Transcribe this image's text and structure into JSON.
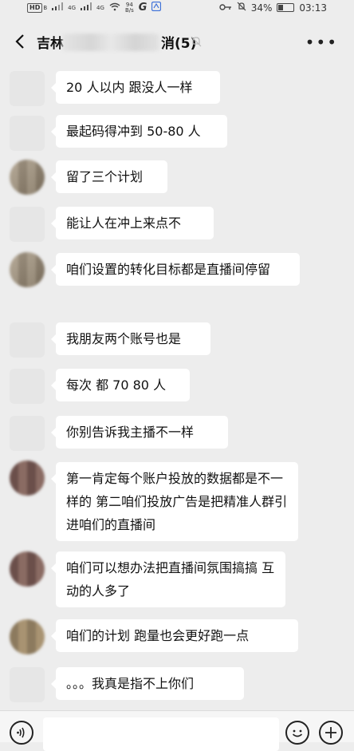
{
  "status_bar": {
    "net_badge": "HD",
    "net_badge_sub": "B",
    "signal1": "4G",
    "signal2": "4G",
    "speed_value": "94",
    "speed_unit": "B/s",
    "app_icon1": "G",
    "battery_percent": "34%",
    "time": "03:13"
  },
  "header": {
    "title_prefix": "吉林",
    "title_suffix": "消(5)",
    "back_icon": "chevron-left",
    "mute_icon": "bell-off",
    "more_icon": "ellipsis"
  },
  "messages": [
    {
      "text": "20 人以内 跟没人一样",
      "avatar": "blank"
    },
    {
      "text": "最起码得冲到 50-80 人",
      "avatar": "blank"
    },
    {
      "text": "留了三个计划",
      "avatar": "pix"
    },
    {
      "text": "能让人在冲上来点不",
      "avatar": "blank"
    },
    {
      "text": "咱们设置的转化目标都是直播间停留",
      "avatar": "pix"
    },
    {
      "text": "我朋友两个账号也是",
      "avatar": "blank"
    },
    {
      "text": "每次 都  70 80 人",
      "avatar": "blank"
    },
    {
      "text": "你别告诉我主播不一样",
      "avatar": "blank"
    },
    {
      "text": "第一肯定每个账户投放的数据都是不一样的  第二咱们投放广告是把精准人群引进咱们的直播间",
      "avatar": "pix-dark"
    },
    {
      "text": "咱们可以想办法把直播间氛围搞搞  互动的人多了",
      "avatar": "pix-dark"
    },
    {
      "text": "咱们的计划 跑量也会更好跑一点",
      "avatar": "pix-warm"
    },
    {
      "text": "。。。我真是指不上你们",
      "avatar": "blank"
    }
  ],
  "input_bar": {
    "voice_icon": "voice",
    "emoji_icon": "smile",
    "plus_icon": "plus"
  }
}
